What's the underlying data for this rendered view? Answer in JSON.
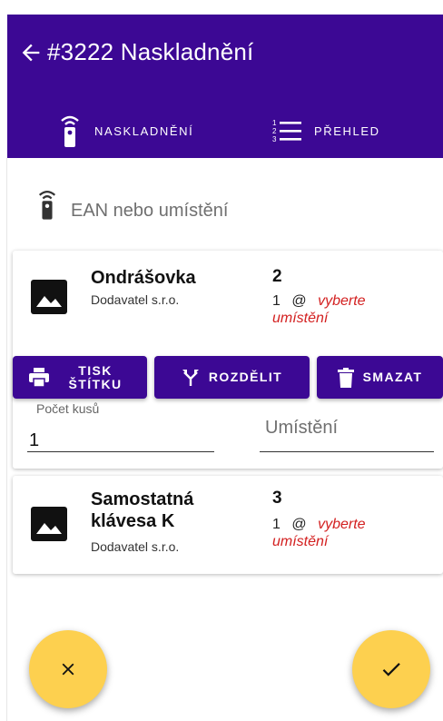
{
  "header": {
    "title": "#3222 Naskladnění"
  },
  "tabs": [
    {
      "label": "NASKLADNĚNÍ",
      "icon": "remote-icon"
    },
    {
      "label": "PŘEHLED",
      "icon": "list-icon"
    }
  ],
  "search": {
    "placeholder": "EAN nebo umístění"
  },
  "items": [
    {
      "name": "Ondrášovka",
      "supplier": "Dodavatel s.r.o.",
      "qty": "2",
      "count": "1",
      "at": "@",
      "location_hint": "vyberte umístění"
    },
    {
      "name": "Samostatná klávesa K",
      "supplier": "Dodavatel s.r.o.",
      "qty": "3",
      "count": "1",
      "at": "@",
      "location_hint": "vyberte umístění"
    }
  ],
  "actions": {
    "print_label": "TISK ŠTÍTKU",
    "split": "ROZDĚLIT",
    "delete": "SMAZAT"
  },
  "edit": {
    "count_label": "Počet kusů",
    "count_value": "1",
    "location_placeholder": "Umístění"
  },
  "colors": {
    "primary": "#3c0894",
    "fab": "#fdd04f",
    "warning": "#d32020"
  }
}
